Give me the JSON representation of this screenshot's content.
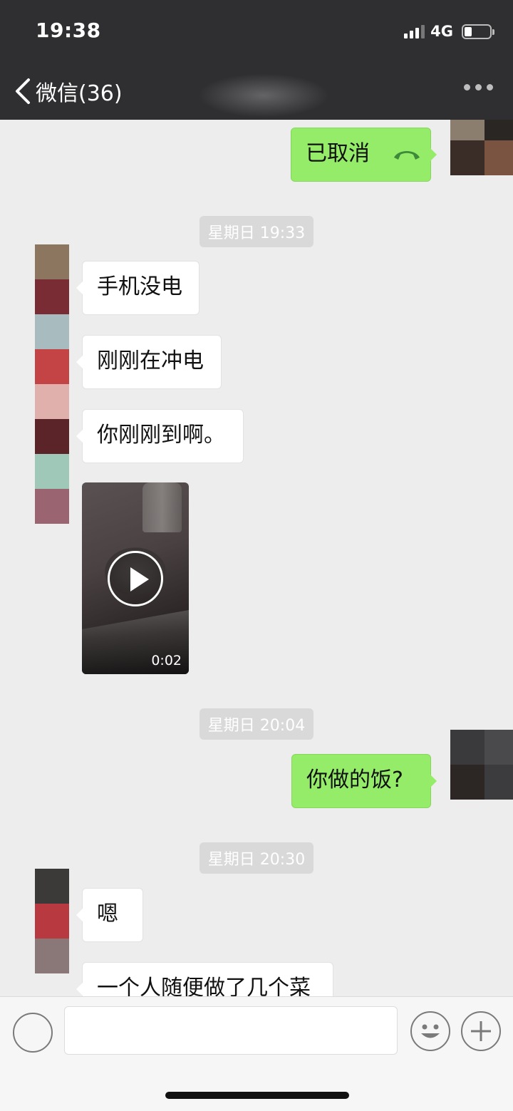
{
  "status_bar": {
    "time": "19:38",
    "network": "4G"
  },
  "nav": {
    "back_label": "微信(36)"
  },
  "messages": {
    "cancelled_call": "已取消",
    "ts1": "星期日 19:33",
    "m1": "手机没电",
    "m2": "刚刚在冲电",
    "m3": "你刚刚到啊。",
    "video_duration": "0:02",
    "ts2": "星期日 20:04",
    "m4": "你做的饭?",
    "ts3": "星期日 20:30",
    "m5": "嗯",
    "m6": "一个人随便做了几个菜"
  },
  "colors": {
    "outgoing_bubble": "#95ec69",
    "incoming_bubble": "#ffffff",
    "chat_background": "#ededed",
    "header_background": "#2f2f31"
  },
  "icons": [
    "chevron-left-icon",
    "more-dots-icon",
    "hangup-phone-icon",
    "play-icon",
    "voice-icon",
    "emoji-icon",
    "plus-icon"
  ]
}
